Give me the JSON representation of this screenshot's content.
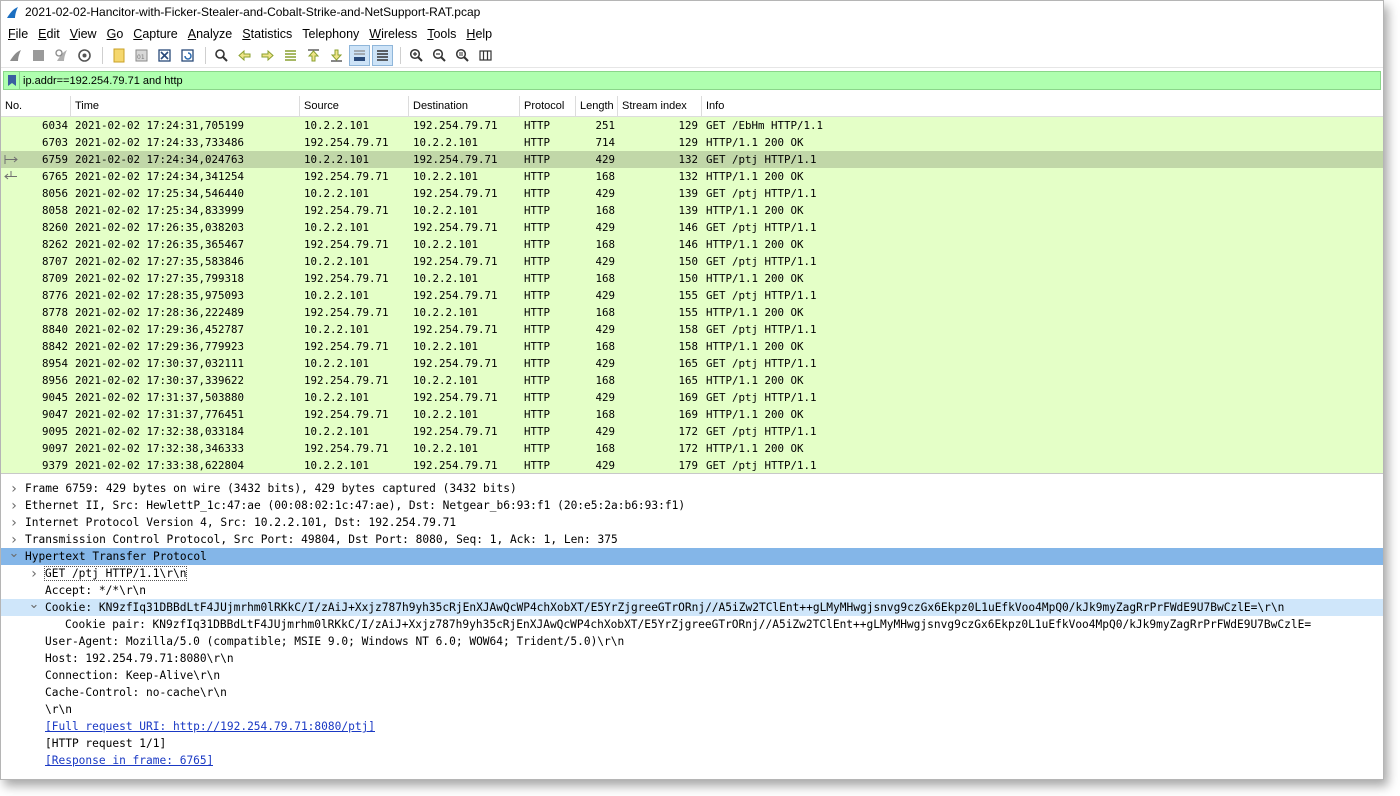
{
  "window": {
    "title": "2021-02-02-Hancitor-with-Ficker-Stealer-and-Cobalt-Strike-and-NetSupport-RAT.pcap"
  },
  "menu": [
    {
      "label": "File",
      "key": "F",
      "rest": "ile"
    },
    {
      "label": "Edit",
      "key": "E",
      "rest": "dit"
    },
    {
      "label": "View",
      "key": "V",
      "rest": "iew"
    },
    {
      "label": "Go",
      "key": "G",
      "rest": "o"
    },
    {
      "label": "Capture",
      "key": "C",
      "rest": "apture"
    },
    {
      "label": "Analyze",
      "key": "A",
      "rest": "nalyze"
    },
    {
      "label": "Statistics",
      "key": "S",
      "rest": "tatistics"
    },
    {
      "label": "Telephony",
      "key": "",
      "rest": "Telephony"
    },
    {
      "label": "Wireless",
      "key": "W",
      "rest": "ireless"
    },
    {
      "label": "Tools",
      "key": "T",
      "rest": "ools"
    },
    {
      "label": "Help",
      "key": "H",
      "rest": "elp"
    }
  ],
  "filter": {
    "value": "ip.addr==192.254.79.71 and http"
  },
  "columns": [
    "No.",
    "Time",
    "Source",
    "Destination",
    "Protocol",
    "Length",
    "Stream index",
    "Info"
  ],
  "packets": [
    {
      "no": "6034",
      "time": "2021-02-02 17:24:31,705199",
      "src": "10.2.2.101",
      "dst": "192.254.79.71",
      "proto": "HTTP",
      "len": "251",
      "stream": "129",
      "info": "GET /EbHm HTTP/1.1"
    },
    {
      "no": "6703",
      "time": "2021-02-02 17:24:33,733486",
      "src": "192.254.79.71",
      "dst": "10.2.2.101",
      "proto": "HTTP",
      "len": "714",
      "stream": "129",
      "info": "HTTP/1.1 200 OK"
    },
    {
      "no": "6759",
      "time": "2021-02-02 17:24:34,024763",
      "src": "10.2.2.101",
      "dst": "192.254.79.71",
      "proto": "HTTP",
      "len": "429",
      "stream": "132",
      "info": "GET /ptj HTTP/1.1"
    },
    {
      "no": "6765",
      "time": "2021-02-02 17:24:34,341254",
      "src": "192.254.79.71",
      "dst": "10.2.2.101",
      "proto": "HTTP",
      "len": "168",
      "stream": "132",
      "info": "HTTP/1.1 200 OK"
    },
    {
      "no": "8056",
      "time": "2021-02-02 17:25:34,546440",
      "src": "10.2.2.101",
      "dst": "192.254.79.71",
      "proto": "HTTP",
      "len": "429",
      "stream": "139",
      "info": "GET /ptj HTTP/1.1"
    },
    {
      "no": "8058",
      "time": "2021-02-02 17:25:34,833999",
      "src": "192.254.79.71",
      "dst": "10.2.2.101",
      "proto": "HTTP",
      "len": "168",
      "stream": "139",
      "info": "HTTP/1.1 200 OK"
    },
    {
      "no": "8260",
      "time": "2021-02-02 17:26:35,038203",
      "src": "10.2.2.101",
      "dst": "192.254.79.71",
      "proto": "HTTP",
      "len": "429",
      "stream": "146",
      "info": "GET /ptj HTTP/1.1"
    },
    {
      "no": "8262",
      "time": "2021-02-02 17:26:35,365467",
      "src": "192.254.79.71",
      "dst": "10.2.2.101",
      "proto": "HTTP",
      "len": "168",
      "stream": "146",
      "info": "HTTP/1.1 200 OK"
    },
    {
      "no": "8707",
      "time": "2021-02-02 17:27:35,583846",
      "src": "10.2.2.101",
      "dst": "192.254.79.71",
      "proto": "HTTP",
      "len": "429",
      "stream": "150",
      "info": "GET /ptj HTTP/1.1"
    },
    {
      "no": "8709",
      "time": "2021-02-02 17:27:35,799318",
      "src": "192.254.79.71",
      "dst": "10.2.2.101",
      "proto": "HTTP",
      "len": "168",
      "stream": "150",
      "info": "HTTP/1.1 200 OK"
    },
    {
      "no": "8776",
      "time": "2021-02-02 17:28:35,975093",
      "src": "10.2.2.101",
      "dst": "192.254.79.71",
      "proto": "HTTP",
      "len": "429",
      "stream": "155",
      "info": "GET /ptj HTTP/1.1"
    },
    {
      "no": "8778",
      "time": "2021-02-02 17:28:36,222489",
      "src": "192.254.79.71",
      "dst": "10.2.2.101",
      "proto": "HTTP",
      "len": "168",
      "stream": "155",
      "info": "HTTP/1.1 200 OK"
    },
    {
      "no": "8840",
      "time": "2021-02-02 17:29:36,452787",
      "src": "10.2.2.101",
      "dst": "192.254.79.71",
      "proto": "HTTP",
      "len": "429",
      "stream": "158",
      "info": "GET /ptj HTTP/1.1"
    },
    {
      "no": "8842",
      "time": "2021-02-02 17:29:36,779923",
      "src": "192.254.79.71",
      "dst": "10.2.2.101",
      "proto": "HTTP",
      "len": "168",
      "stream": "158",
      "info": "HTTP/1.1 200 OK"
    },
    {
      "no": "8954",
      "time": "2021-02-02 17:30:37,032111",
      "src": "10.2.2.101",
      "dst": "192.254.79.71",
      "proto": "HTTP",
      "len": "429",
      "stream": "165",
      "info": "GET /ptj HTTP/1.1"
    },
    {
      "no": "8956",
      "time": "2021-02-02 17:30:37,339622",
      "src": "192.254.79.71",
      "dst": "10.2.2.101",
      "proto": "HTTP",
      "len": "168",
      "stream": "165",
      "info": "HTTP/1.1 200 OK"
    },
    {
      "no": "9045",
      "time": "2021-02-02 17:31:37,503880",
      "src": "10.2.2.101",
      "dst": "192.254.79.71",
      "proto": "HTTP",
      "len": "429",
      "stream": "169",
      "info": "GET /ptj HTTP/1.1"
    },
    {
      "no": "9047",
      "time": "2021-02-02 17:31:37,776451",
      "src": "192.254.79.71",
      "dst": "10.2.2.101",
      "proto": "HTTP",
      "len": "168",
      "stream": "169",
      "info": "HTTP/1.1 200 OK"
    },
    {
      "no": "9095",
      "time": "2021-02-02 17:32:38,033184",
      "src": "10.2.2.101",
      "dst": "192.254.79.71",
      "proto": "HTTP",
      "len": "429",
      "stream": "172",
      "info": "GET /ptj HTTP/1.1"
    },
    {
      "no": "9097",
      "time": "2021-02-02 17:32:38,346333",
      "src": "192.254.79.71",
      "dst": "10.2.2.101",
      "proto": "HTTP",
      "len": "168",
      "stream": "172",
      "info": "HTTP/1.1 200 OK"
    },
    {
      "no": "9379",
      "time": "2021-02-02 17:33:38,622804",
      "src": "10.2.2.101",
      "dst": "192.254.79.71",
      "proto": "HTTP",
      "len": "429",
      "stream": "179",
      "info": "GET /ptj HTTP/1.1"
    }
  ],
  "selected_packet": "6759",
  "related_packet": "6765",
  "details": [
    {
      "level": 0,
      "chev": "right",
      "text": "Frame 6759: 429 bytes on wire (3432 bits), 429 bytes captured (3432 bits)",
      "style": ""
    },
    {
      "level": 0,
      "chev": "right",
      "text": "Ethernet II, Src: HewlettP_1c:47:ae (00:08:02:1c:47:ae), Dst: Netgear_b6:93:f1 (20:e5:2a:b6:93:f1)",
      "style": ""
    },
    {
      "level": 0,
      "chev": "right",
      "text": "Internet Protocol Version 4, Src: 10.2.2.101, Dst: 192.254.79.71",
      "style": ""
    },
    {
      "level": 0,
      "chev": "right",
      "text": "Transmission Control Protocol, Src Port: 49804, Dst Port: 8080, Seq: 1, Ack: 1, Len: 375",
      "style": ""
    },
    {
      "level": 0,
      "chev": "down",
      "text": "Hypertext Transfer Protocol",
      "style": "selected"
    },
    {
      "level": 1,
      "chev": "right",
      "text": "GET /ptj HTTP/1.1\\r\\n",
      "style": "boxed"
    },
    {
      "level": 1,
      "chev": "",
      "text": "Accept: */*\\r\\n",
      "style": ""
    },
    {
      "level": 1,
      "chev": "down",
      "text": "Cookie: KN9zfIq31DBBdLtF4JUjmrhm0lRKkC/I/zAiJ+Xxjz787h9yh35cRjEnXJAwQcWP4chXobXT/E5YrZjgreeGTrORnj//A5iZw2TClEnt++gLMyMHwgjsnvg9czGx6Ekpz0L1uEfkVoo4MpQ0/kJk9myZagRrPrFWdE9U7BwCzlE=\\r\\n",
      "style": "highlight"
    },
    {
      "level": 2,
      "chev": "",
      "text": "Cookie pair: KN9zfIq31DBBdLtF4JUjmrhm0lRKkC/I/zAiJ+Xxjz787h9yh35cRjEnXJAwQcWP4chXobXT/E5YrZjgreeGTrORnj//A5iZw2TClEnt++gLMyMHwgjsnvg9czGx6Ekpz0L1uEfkVoo4MpQ0/kJk9myZagRrPrFWdE9U7BwCzlE=",
      "style": ""
    },
    {
      "level": 1,
      "chev": "",
      "text": "User-Agent: Mozilla/5.0 (compatible; MSIE 9.0; Windows NT 6.0; WOW64; Trident/5.0)\\r\\n",
      "style": ""
    },
    {
      "level": 1,
      "chev": "",
      "text": "Host: 192.254.79.71:8080\\r\\n",
      "style": ""
    },
    {
      "level": 1,
      "chev": "",
      "text": "Connection: Keep-Alive\\r\\n",
      "style": ""
    },
    {
      "level": 1,
      "chev": "",
      "text": "Cache-Control: no-cache\\r\\n",
      "style": ""
    },
    {
      "level": 1,
      "chev": "",
      "text": "\\r\\n",
      "style": ""
    },
    {
      "level": 1,
      "chev": "",
      "text": "[Full request URI: http://192.254.79.71:8080/ptj]",
      "style": "link"
    },
    {
      "level": 1,
      "chev": "",
      "text": "[HTTP request 1/1]",
      "style": ""
    },
    {
      "level": 1,
      "chev": "",
      "text": "[Response in frame: 6765]",
      "style": "link"
    }
  ],
  "toolbar_icons": [
    "shark-fin-start-icon",
    "stop-capture-icon",
    "restart-capture-icon",
    "capture-options-icon",
    "open-file-icon",
    "save-file-icon",
    "close-file-icon",
    "reload-file-icon",
    "find-packet-icon",
    "go-back-icon",
    "go-forward-icon",
    "go-to-packet-icon",
    "go-first-icon",
    "go-last-icon",
    "autoscroll-icon",
    "colorize-icon",
    "zoom-in-icon",
    "zoom-out-icon",
    "zoom-normal-icon",
    "resize-columns-icon"
  ],
  "colors": {
    "packet_row_bg": "#e4ffc7",
    "packet_selected_bg": "#c1d7a8",
    "filter_bg": "#afffaf",
    "detail_selected_bg": "#84b6e8",
    "detail_highlight_bg": "#cfe6fa",
    "link_color": "#1a39c4"
  }
}
